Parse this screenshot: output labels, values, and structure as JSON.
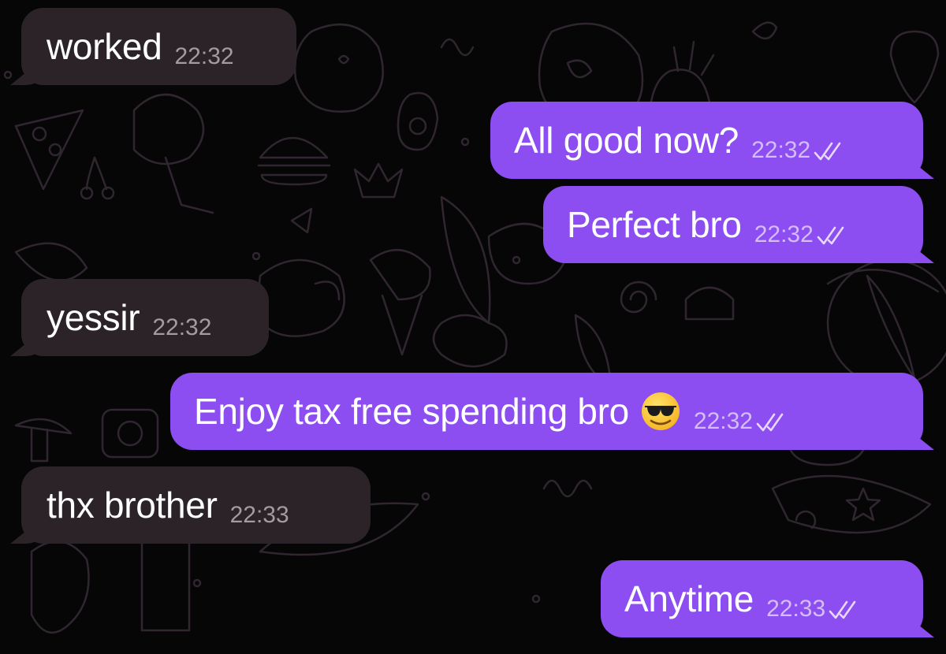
{
  "colors": {
    "background": "#060606",
    "incoming_bubble": "#2c2329",
    "outgoing_bubble": "#8c4ef0",
    "doodle": "#2f2630"
  },
  "messages": [
    {
      "direction": "incoming",
      "text": "worked",
      "time": "22:32"
    },
    {
      "direction": "outgoing",
      "text": "All good now?",
      "time": "22:32",
      "status": "read-double-check"
    },
    {
      "direction": "outgoing",
      "text": "Perfect bro",
      "time": "22:32",
      "status": "read-double-check"
    },
    {
      "direction": "incoming",
      "text": "yessir",
      "time": "22:32"
    },
    {
      "direction": "outgoing",
      "text": "Enjoy tax free spending bro",
      "emoji": "smiling-face-with-sunglasses",
      "time": "22:32",
      "status": "read-double-check"
    },
    {
      "direction": "incoming",
      "text": "thx brother",
      "time": "22:33"
    },
    {
      "direction": "outgoing",
      "text": "Anytime",
      "time": "22:33",
      "status": "read-double-check"
    }
  ]
}
